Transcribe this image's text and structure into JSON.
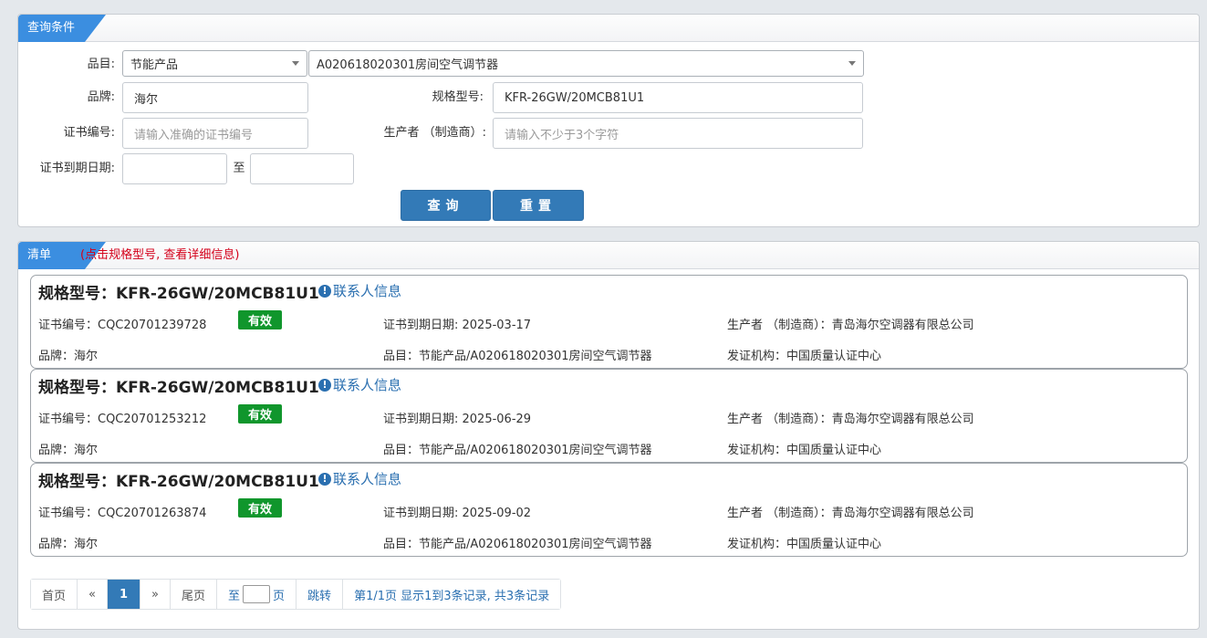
{
  "query_panel": {
    "title": "查询条件",
    "category_label": "品目:",
    "category_value": "节能产品",
    "subcategory_value": "A020618020301房间空气调节器",
    "brand_label": "品牌:",
    "brand_value": "海尔",
    "model_label": "规格型号:",
    "model_value": "KFR-26GW/20MCB81U1",
    "cert_label": "证书编号:",
    "cert_placeholder": "请输入准确的证书编号",
    "maker_label": "生产者 （制造商）:",
    "maker_placeholder": "请输入不少于3个字符",
    "expiry_label": "证书到期日期:",
    "to_label": "至",
    "search_button": "查询",
    "reset_button": "重置"
  },
  "list_panel": {
    "title": "清单",
    "hint": "(点击规格型号, 查看详细信息)",
    "items": [
      {
        "model": "规格型号：KFR-26GW/20MCB81U1",
        "contact": "联系人信息",
        "cert": "证书编号：CQC20701239728",
        "status": "有效",
        "expiry": "证书到期日期: 2025-03-17",
        "maker": "生产者 （制造商）：青岛海尔空调器有限总公司",
        "brand": "品牌：海尔",
        "category": "品目：节能产品/A020618020301房间空气调节器",
        "issuer": "发证机构：中国质量认证中心"
      },
      {
        "model": "规格型号：KFR-26GW/20MCB81U1",
        "contact": "联系人信息",
        "cert": "证书编号：CQC20701253212",
        "status": "有效",
        "expiry": "证书到期日期: 2025-06-29",
        "maker": "生产者 （制造商）：青岛海尔空调器有限总公司",
        "brand": "品牌：海尔",
        "category": "品目：节能产品/A020618020301房间空气调节器",
        "issuer": "发证机构：中国质量认证中心"
      },
      {
        "model": "规格型号：KFR-26GW/20MCB81U1",
        "contact": "联系人信息",
        "cert": "证书编号：CQC20701263874",
        "status": "有效",
        "expiry": "证书到期日期: 2025-09-02",
        "maker": "生产者 （制造商）：青岛海尔空调器有限总公司",
        "brand": "品牌：海尔",
        "category": "品目：节能产品/A020618020301房间空气调节器",
        "issuer": "发证机构：中国质量认证中心"
      }
    ]
  },
  "pagination": {
    "first": "首页",
    "prev": "«",
    "current": "1",
    "next": "»",
    "last": "尾页",
    "to": "至",
    "page_unit": "页",
    "jump": "跳转",
    "summary": "第1/1页  显示1到3条记录, 共3条记录"
  },
  "colors": {
    "accent": "#3b8ee0",
    "button": "#337ab7",
    "valid_badge": "#10962c",
    "hint": "#d4001a"
  }
}
